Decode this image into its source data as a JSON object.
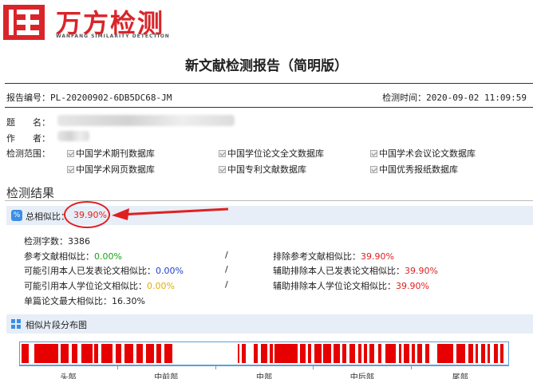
{
  "logo": {
    "cn_text": "万方检测",
    "en_text": "WANFANG SIMILARITY DETECTION"
  },
  "report": {
    "title": "新文献检测报告（简明版）",
    "number_label": "报告编号：",
    "number": "PL-20200902-6DB5DC68-JM",
    "time_label": "检测时间：",
    "time": "2020-09-02 11:09:59",
    "title_label": "题　　名：",
    "author_label": "作　　者：",
    "scope_label": "检测范围："
  },
  "databases": [
    "中国学术期刊数据库",
    "中国学位论文全文数据库",
    "中国学术会议论文数据库",
    "中国学术网页数据库",
    "中国专利文献数据库",
    "中国优秀报纸数据库"
  ],
  "results": {
    "section_title": "检测结果",
    "total_label": "总相似比：",
    "total_value": "39.90%",
    "word_count_label": "检测字数：",
    "word_count": "3386",
    "ref_sim_label": "参考文献相似比：",
    "ref_sim_value": "0.00%",
    "excl_ref_label": "排除参考文献相似比：",
    "excl_ref_value": "39.90%",
    "own_pub_label": "可能引用本人已发表论文相似比：",
    "own_pub_value": "0.00%",
    "aux_excl_pub_label": "辅助排除本人已发表论文相似比：",
    "aux_excl_pub_value": "39.90%",
    "own_degree_label": "可能引用本人学位论文相似比：",
    "own_degree_value": "0.00%",
    "aux_excl_degree_label": "辅助排除本人学位论文相似比：",
    "aux_excl_degree_value": "39.90%",
    "max_single_label": "单篇论文最大相似比：",
    "max_single_value": "16.30%",
    "separator": "/"
  },
  "distribution": {
    "title": "相似片段分布图",
    "section_labels": [
      "头部",
      "中前部",
      "中部",
      "中后部",
      "尾部"
    ],
    "highlight_color": "#e60000",
    "border_color": "#5aa0d8",
    "segments": [
      [
        0.003,
        0.018
      ],
      [
        0.03,
        0.078
      ],
      [
        0.084,
        0.1
      ],
      [
        0.106,
        0.118
      ],
      [
        0.125,
        0.148
      ],
      [
        0.152,
        0.16
      ],
      [
        0.166,
        0.19
      ],
      [
        0.196,
        0.208
      ],
      [
        0.214,
        0.232
      ],
      [
        0.238,
        0.252
      ],
      [
        0.258,
        0.275
      ],
      [
        0.28,
        0.29
      ],
      [
        0.296,
        0.312
      ],
      [
        0.446,
        0.45
      ],
      [
        0.455,
        0.462
      ],
      [
        0.478,
        0.487
      ],
      [
        0.494,
        0.506
      ],
      [
        0.511,
        0.518
      ],
      [
        0.522,
        0.568
      ],
      [
        0.574,
        0.585
      ],
      [
        0.59,
        0.596
      ],
      [
        0.603,
        0.617
      ],
      [
        0.621,
        0.638
      ],
      [
        0.642,
        0.655
      ],
      [
        0.66,
        0.668
      ],
      [
        0.675,
        0.686
      ],
      [
        0.692,
        0.7
      ],
      [
        0.705,
        0.71
      ],
      [
        0.716,
        0.726
      ],
      [
        0.734,
        0.741
      ],
      [
        0.748,
        0.77
      ],
      [
        0.776,
        0.781
      ],
      [
        0.786,
        0.797
      ],
      [
        0.803,
        0.809
      ],
      [
        0.814,
        0.823
      ],
      [
        0.83,
        0.839
      ],
      [
        0.855,
        0.888
      ],
      [
        0.893,
        0.912
      ],
      [
        0.918,
        0.928
      ],
      [
        0.933,
        0.938
      ],
      [
        0.944,
        0.952
      ],
      [
        0.957,
        0.963
      ],
      [
        0.97,
        0.978
      ],
      [
        0.984,
        0.99
      ]
    ]
  },
  "annotation": {
    "marker_color": "#e02020"
  }
}
